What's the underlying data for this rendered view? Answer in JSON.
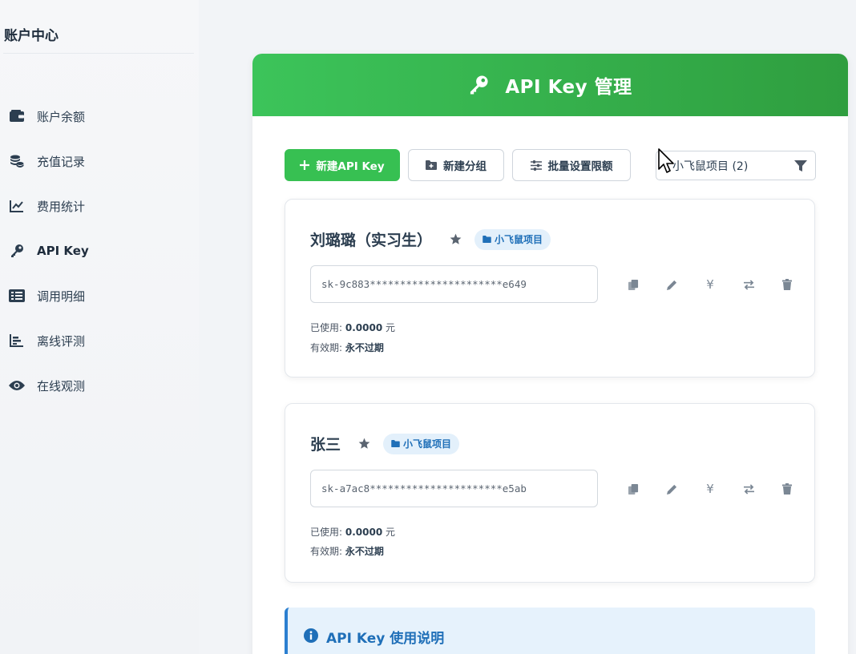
{
  "sidebar": {
    "title": "账户中心",
    "items": [
      {
        "label": "账户余额",
        "icon": "wallet-icon"
      },
      {
        "label": "充值记录",
        "icon": "coins-icon"
      },
      {
        "label": "费用统计",
        "icon": "line-chart-icon"
      },
      {
        "label": "API Key",
        "icon": "key-icon",
        "active": true
      },
      {
        "label": "调用明细",
        "icon": "list-icon"
      },
      {
        "label": "离线评测",
        "icon": "bar-chart-icon"
      },
      {
        "label": "在线观测",
        "icon": "eye-icon"
      }
    ]
  },
  "banner": {
    "title": "API Key 管理",
    "icon": "key-icon"
  },
  "toolbar": {
    "new_key_label": "新建API Key",
    "new_group_label": "新建分组",
    "batch_limit_label": "批量设置限额",
    "group_filter_value": "小飞鼠项目 (2)"
  },
  "keys": [
    {
      "name": "刘璐璐（实习生）",
      "group": "小飞鼠项目",
      "key": "sk-9c883**********************e649",
      "used_label": "已使用:",
      "used_value": "0.0000",
      "used_unit": "元",
      "expiry_label": "有效期:",
      "expiry_value": "永不过期"
    },
    {
      "name": "张三",
      "group": "小飞鼠项目",
      "key": "sk-a7ac8**********************e5ab",
      "used_label": "已使用:",
      "used_value": "0.0000",
      "used_unit": "元",
      "expiry_label": "有效期:",
      "expiry_value": "永不过期"
    }
  ],
  "actions": {
    "yuan_symbol": "¥"
  },
  "notice": {
    "title": "API Key 使用说明"
  },
  "colors": {
    "accent": "#37c052",
    "info": "#2b7fd0"
  }
}
